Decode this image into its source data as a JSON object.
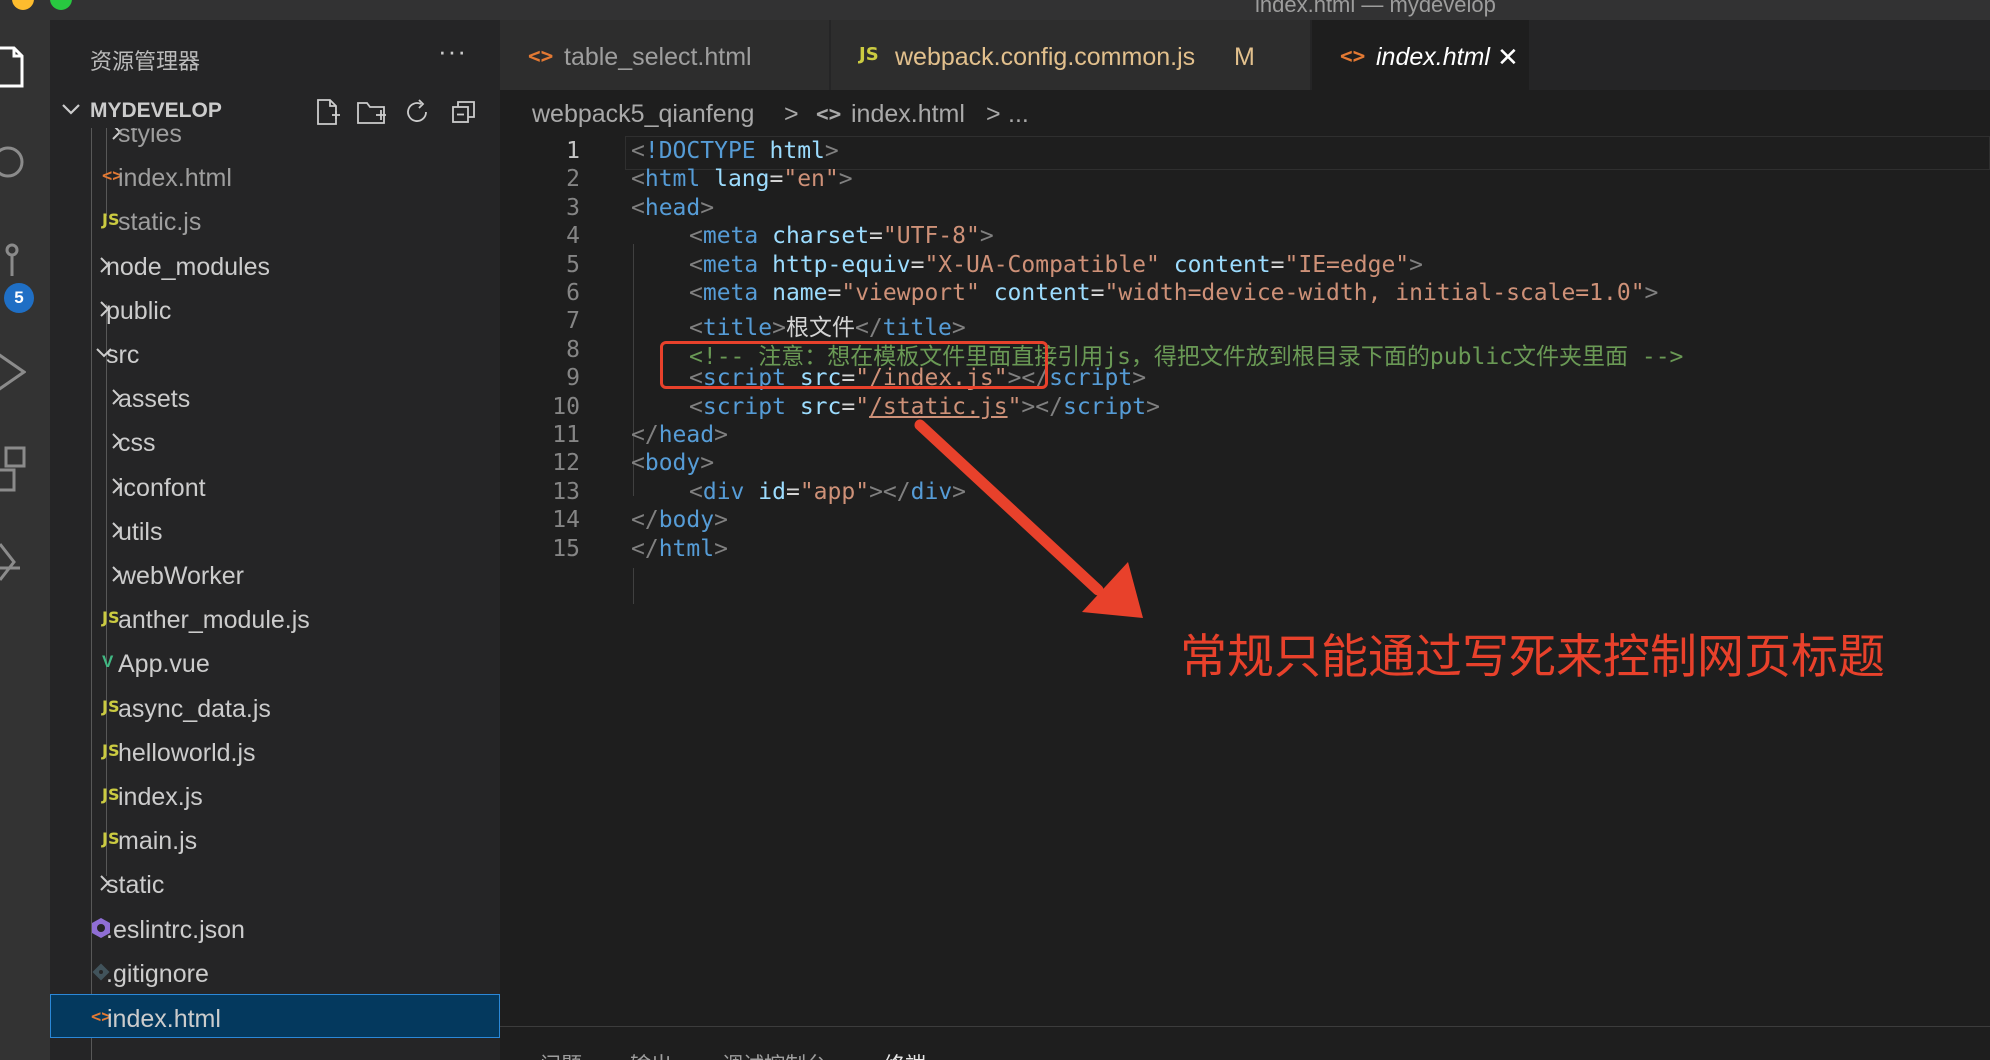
{
  "window": {
    "title": "index.html — mydevelop"
  },
  "activity_bar": {
    "items": [
      {
        "icon": "files-icon"
      },
      {
        "icon": "search-icon"
      },
      {
        "icon": "source-control-icon",
        "badge": "5"
      },
      {
        "icon": "run-debug-icon"
      },
      {
        "icon": "extensions-icon"
      },
      {
        "icon": "remote-explorer-icon"
      }
    ]
  },
  "sidebar": {
    "title": "资源管理器",
    "more": "···",
    "section": {
      "title": "MYDEVELOP",
      "actions": [
        "new-file-icon",
        "new-folder-icon",
        "refresh-icon",
        "collapse-all-icon"
      ]
    },
    "tree": [
      {
        "label": "styles",
        "kind": "folder",
        "depth": 2,
        "open": false
      },
      {
        "label": "index.html",
        "kind": "html",
        "depth": 2
      },
      {
        "label": "static.js",
        "kind": "js",
        "depth": 2
      },
      {
        "label": "node_modules",
        "kind": "folder",
        "depth": 1,
        "open": false
      },
      {
        "label": "public",
        "kind": "folder",
        "depth": 1,
        "open": false
      },
      {
        "label": "src",
        "kind": "folder",
        "depth": 1,
        "open": true
      },
      {
        "label": "assets",
        "kind": "folder",
        "depth": 2,
        "open": false
      },
      {
        "label": "css",
        "kind": "folder",
        "depth": 2,
        "open": false
      },
      {
        "label": "iconfont",
        "kind": "folder",
        "depth": 2,
        "open": false
      },
      {
        "label": "utils",
        "kind": "folder",
        "depth": 2,
        "open": false
      },
      {
        "label": "webWorker",
        "kind": "folder",
        "depth": 2,
        "open": false
      },
      {
        "label": "anther_module.js",
        "kind": "js",
        "depth": 2
      },
      {
        "label": "App.vue",
        "kind": "vue",
        "depth": 2
      },
      {
        "label": "async_data.js",
        "kind": "js",
        "depth": 2
      },
      {
        "label": "helloworld.js",
        "kind": "js",
        "depth": 2
      },
      {
        "label": "index.js",
        "kind": "js",
        "depth": 2
      },
      {
        "label": "main.js",
        "kind": "js",
        "depth": 2
      },
      {
        "label": "static",
        "kind": "folder",
        "depth": 1,
        "open": false
      },
      {
        "label": ".eslintrc.json",
        "kind": "eslint",
        "depth": 1
      },
      {
        "label": ".gitignore",
        "kind": "git",
        "depth": 1
      },
      {
        "label": "index.html",
        "kind": "html",
        "depth": 1,
        "selected": true
      }
    ]
  },
  "tabs": [
    {
      "label": "table_select.html",
      "icon": "<>",
      "active": false
    },
    {
      "label": "webpack.config.common.js",
      "icon": "JS",
      "modified": "M",
      "active": false
    },
    {
      "label": "index.html",
      "icon": "<>",
      "active": true,
      "close": "✕"
    }
  ],
  "breadcrumb": {
    "folder": "webpack5_qianfeng",
    "sep": ">",
    "file": "index.html",
    "ellipsis": "..."
  },
  "editor": {
    "current_line": "1",
    "lines": [
      {
        "n": "1",
        "indent": 0,
        "tokens": [
          [
            "punc",
            "<"
          ],
          [
            "tag",
            "!DOCTYPE"
          ],
          [
            "text",
            " "
          ],
          [
            "attr",
            "html"
          ],
          [
            "punc",
            ">"
          ]
        ]
      },
      {
        "n": "2",
        "indent": 0,
        "tokens": [
          [
            "punc",
            "<"
          ],
          [
            "tag",
            "html"
          ],
          [
            "text",
            " "
          ],
          [
            "attr",
            "lang"
          ],
          [
            "text",
            "="
          ],
          [
            "str",
            "\"en\""
          ],
          [
            "punc",
            ">"
          ]
        ]
      },
      {
        "n": "3",
        "indent": 0,
        "tokens": [
          [
            "punc",
            "<"
          ],
          [
            "tag",
            "head"
          ],
          [
            "punc",
            ">"
          ]
        ]
      },
      {
        "n": "4",
        "indent": 1,
        "tokens": [
          [
            "punc",
            "<"
          ],
          [
            "tag",
            "meta"
          ],
          [
            "text",
            " "
          ],
          [
            "attr",
            "charset"
          ],
          [
            "text",
            "="
          ],
          [
            "str",
            "\"UTF-8\""
          ],
          [
            "punc",
            ">"
          ]
        ]
      },
      {
        "n": "5",
        "indent": 1,
        "tokens": [
          [
            "punc",
            "<"
          ],
          [
            "tag",
            "meta"
          ],
          [
            "text",
            " "
          ],
          [
            "attr",
            "http-equiv"
          ],
          [
            "text",
            "="
          ],
          [
            "str",
            "\"X-UA-Compatible\""
          ],
          [
            "text",
            " "
          ],
          [
            "attr",
            "content"
          ],
          [
            "text",
            "="
          ],
          [
            "str",
            "\"IE=edge\""
          ],
          [
            "punc",
            ">"
          ]
        ]
      },
      {
        "n": "6",
        "indent": 1,
        "tokens": [
          [
            "punc",
            "<"
          ],
          [
            "tag",
            "meta"
          ],
          [
            "text",
            " "
          ],
          [
            "attr",
            "name"
          ],
          [
            "text",
            "="
          ],
          [
            "str",
            "\"viewport\""
          ],
          [
            "text",
            " "
          ],
          [
            "attr",
            "content"
          ],
          [
            "text",
            "="
          ],
          [
            "str",
            "\"width=device-width, initial-scale=1.0\""
          ],
          [
            "punc",
            ">"
          ]
        ]
      },
      {
        "n": "7",
        "indent": 1,
        "tokens": [
          [
            "punc",
            "<"
          ],
          [
            "tag",
            "title"
          ],
          [
            "punc",
            ">"
          ],
          [
            "text",
            "根文件"
          ],
          [
            "punc",
            "</"
          ],
          [
            "tag",
            "title"
          ],
          [
            "punc",
            ">"
          ]
        ]
      },
      {
        "n": "8",
        "indent": 1,
        "tokens": [
          [
            "comment",
            "<!-- 注意：想在模板文件里面直接引用js，得把文件放到根目录下面的public文件夹里面 -->"
          ]
        ]
      },
      {
        "n": "9",
        "indent": 1,
        "tokens": [
          [
            "punc",
            "<"
          ],
          [
            "tag",
            "script"
          ],
          [
            "text",
            " "
          ],
          [
            "attr",
            "src"
          ],
          [
            "text",
            "="
          ],
          [
            "str",
            "\""
          ],
          [
            "strul",
            "/index.js"
          ],
          [
            "str",
            "\""
          ],
          [
            "punc",
            "></"
          ],
          [
            "tag",
            "script"
          ],
          [
            "punc",
            ">"
          ]
        ]
      },
      {
        "n": "10",
        "indent": 1,
        "tokens": [
          [
            "punc",
            "<"
          ],
          [
            "tag",
            "script"
          ],
          [
            "text",
            " "
          ],
          [
            "attr",
            "src"
          ],
          [
            "text",
            "="
          ],
          [
            "str",
            "\""
          ],
          [
            "strul",
            "/static.js"
          ],
          [
            "str",
            "\""
          ],
          [
            "punc",
            "></"
          ],
          [
            "tag",
            "script"
          ],
          [
            "punc",
            ">"
          ]
        ]
      },
      {
        "n": "11",
        "indent": 0,
        "tokens": [
          [
            "punc",
            "</"
          ],
          [
            "tag",
            "head"
          ],
          [
            "punc",
            ">"
          ]
        ]
      },
      {
        "n": "12",
        "indent": 0,
        "tokens": [
          [
            "punc",
            "<"
          ],
          [
            "tag",
            "body"
          ],
          [
            "punc",
            ">"
          ]
        ]
      },
      {
        "n": "13",
        "indent": 1,
        "tokens": [
          [
            "punc",
            "<"
          ],
          [
            "tag",
            "div"
          ],
          [
            "text",
            " "
          ],
          [
            "attr",
            "id"
          ],
          [
            "text",
            "="
          ],
          [
            "str",
            "\"app\""
          ],
          [
            "punc",
            "></"
          ],
          [
            "tag",
            "div"
          ],
          [
            "punc",
            ">"
          ]
        ]
      },
      {
        "n": "14",
        "indent": 0,
        "tokens": [
          [
            "punc",
            "</"
          ],
          [
            "tag",
            "body"
          ],
          [
            "punc",
            ">"
          ]
        ]
      },
      {
        "n": "15",
        "indent": 0,
        "tokens": [
          [
            "punc",
            "</"
          ],
          [
            "tag",
            "html"
          ],
          [
            "punc",
            ">"
          ]
        ]
      }
    ]
  },
  "annotation": {
    "text": "常规只能通过写死来控制网页标题",
    "color": "#e8412b"
  },
  "panel": {
    "tabs": [
      {
        "label": "问题"
      },
      {
        "label": "输出"
      },
      {
        "label": "调试控制台"
      },
      {
        "label": "终端",
        "active": true
      }
    ]
  },
  "colors": {
    "accent": "#007acc",
    "badge": "#1f6fc5",
    "modified": "#e2c08d",
    "selection": "#04395e"
  }
}
